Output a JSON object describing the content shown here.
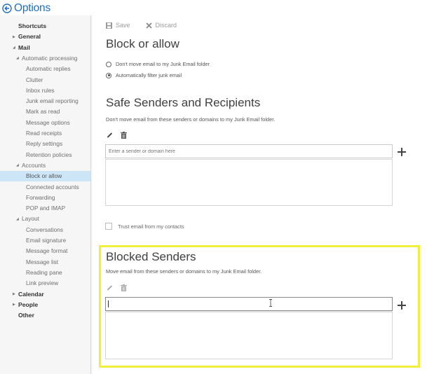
{
  "header": {
    "title": "Options",
    "back_icon": "back-arrow-circle-icon"
  },
  "sidebar": {
    "items": [
      {
        "label": "Shortcuts",
        "level": 0,
        "expand": "none"
      },
      {
        "label": "General",
        "level": 0,
        "expand": "collapsed"
      },
      {
        "label": "Mail",
        "level": 0,
        "expand": "expanded"
      },
      {
        "label": "Automatic processing",
        "level": 1,
        "expand": "expanded"
      },
      {
        "label": "Automatic replies",
        "level": 2,
        "expand": "none"
      },
      {
        "label": "Clutter",
        "level": 2,
        "expand": "none"
      },
      {
        "label": "Inbox rules",
        "level": 2,
        "expand": "none"
      },
      {
        "label": "Junk email reporting",
        "level": 2,
        "expand": "none"
      },
      {
        "label": "Mark as read",
        "level": 2,
        "expand": "none"
      },
      {
        "label": "Message options",
        "level": 2,
        "expand": "none"
      },
      {
        "label": "Read receipts",
        "level": 2,
        "expand": "none"
      },
      {
        "label": "Reply settings",
        "level": 2,
        "expand": "none"
      },
      {
        "label": "Retention policies",
        "level": 2,
        "expand": "none"
      },
      {
        "label": "Accounts",
        "level": 1,
        "expand": "expanded"
      },
      {
        "label": "Block or allow",
        "level": 2,
        "expand": "none",
        "selected": true
      },
      {
        "label": "Connected accounts",
        "level": 2,
        "expand": "none"
      },
      {
        "label": "Forwarding",
        "level": 2,
        "expand": "none"
      },
      {
        "label": "POP and IMAP",
        "level": 2,
        "expand": "none"
      },
      {
        "label": "Layout",
        "level": 1,
        "expand": "expanded"
      },
      {
        "label": "Conversations",
        "level": 2,
        "expand": "none"
      },
      {
        "label": "Email signature",
        "level": 2,
        "expand": "none"
      },
      {
        "label": "Message format",
        "level": 2,
        "expand": "none"
      },
      {
        "label": "Message list",
        "level": 2,
        "expand": "none"
      },
      {
        "label": "Reading pane",
        "level": 2,
        "expand": "none"
      },
      {
        "label": "Link preview",
        "level": 2,
        "expand": "none"
      },
      {
        "label": "Calendar",
        "level": 0,
        "expand": "collapsed"
      },
      {
        "label": "People",
        "level": 0,
        "expand": "collapsed"
      },
      {
        "label": "Other",
        "level": 0,
        "expand": "none"
      }
    ]
  },
  "toolbar": {
    "save_label": "Save",
    "discard_label": "Discard"
  },
  "block_or_allow": {
    "title": "Block or allow",
    "options": [
      {
        "label": "Don't move email to my Junk Email folder",
        "selected": false
      },
      {
        "label": "Automatically filter junk email",
        "selected": true
      }
    ]
  },
  "safe_senders": {
    "title": "Safe Senders and Recipients",
    "description": "Don't move email from these senders or domains to my Junk Email folder.",
    "input_placeholder": "Enter a sender or domain here",
    "input_value": "",
    "entries": [],
    "trust_contacts_label": "Trust email from my contacts",
    "trust_contacts_checked": false
  },
  "blocked_senders": {
    "title": "Blocked Senders",
    "description": "Move email from these senders or domains to my Junk Email folder.",
    "input_value": "",
    "entries": []
  },
  "colors": {
    "accent": "#1e6fc0",
    "selected_nav": "#cde6f7",
    "highlight_box": "#f2ef3a"
  }
}
